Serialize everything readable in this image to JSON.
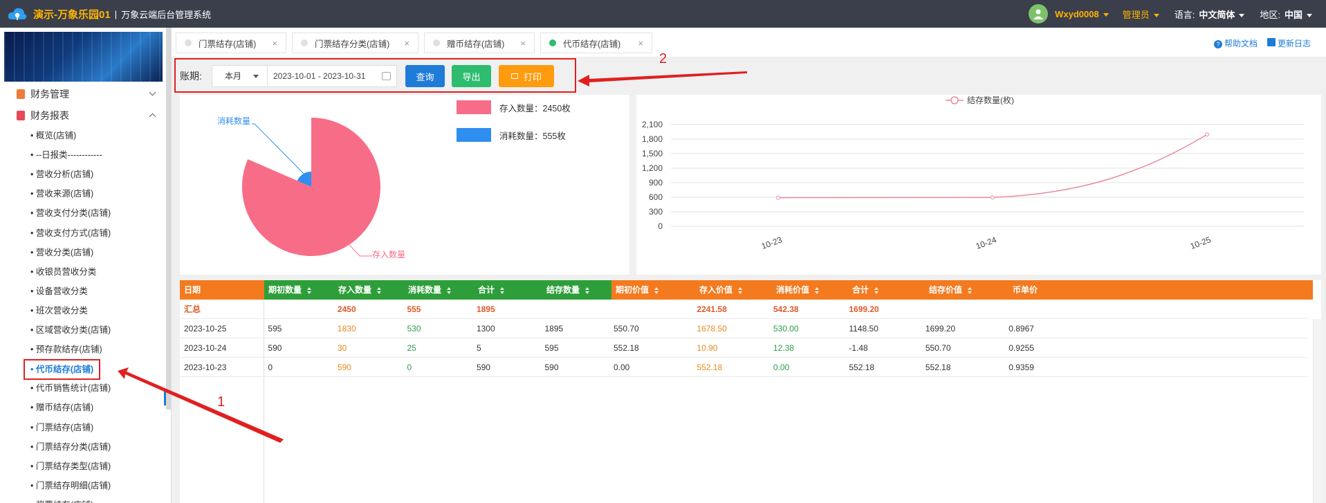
{
  "header": {
    "app_name": "演示-万象乐园01",
    "separator": "|",
    "system_name": "万象云端后台管理系统",
    "username": "Wxyd0008",
    "role": "管理员",
    "language_label": "语言:",
    "language_value": "中文简体",
    "region_label": "地区:",
    "region_value": "中国"
  },
  "sidebar": {
    "groups": [
      {
        "label": "财务管理",
        "icon": "ledger-icon"
      },
      {
        "label": "财务报表",
        "icon": "report-icon"
      }
    ],
    "items": [
      "• 概览(店铺)",
      "• --日报类------------",
      "• 营收分析(店铺)",
      "• 营收来源(店铺)",
      "• 营收支付分类(店铺)",
      "• 营收支付方式(店铺)",
      "• 营收分类(店铺)",
      "• 收银员营收分类",
      "• 设备营收分类",
      "• 班次营收分类",
      "• 区域营收分类(店铺)",
      "• 预存款结存(店铺)",
      "• 代币结存(店铺)",
      "• 代币销售统计(店铺)",
      "• 赠币结存(店铺)",
      "• 门票结存(店铺)",
      "• 门票结存分类(店铺)",
      "• 门票结存类型(店铺)",
      "• 门票结存明细(店铺)",
      "• 奖票结存(店铺)"
    ],
    "active_index": 12
  },
  "tabs": [
    {
      "label": "门票结存(店铺)",
      "active": false
    },
    {
      "label": "门票结存分类(店铺)",
      "active": false
    },
    {
      "label": "赠币结存(店铺)",
      "active": false
    },
    {
      "label": "代币结存(店铺)",
      "active": true
    }
  ],
  "top_links": {
    "help": "帮助文档",
    "changelog": "更新日志"
  },
  "toolbar": {
    "period_label": "账期:",
    "period_value": "本月",
    "date_range": "2023-10-01 - 2023-10-31",
    "query_label": "查询",
    "export_label": "导出",
    "print_label": "打印"
  },
  "annotations": {
    "num1": "1",
    "num2": "2"
  },
  "chart_data": [
    {
      "type": "pie",
      "categories": [
        "存入数量",
        "消耗数量"
      ],
      "values": [
        2450,
        555
      ],
      "legend": [
        "存入数量：2450枚",
        "消耗数量：555枚"
      ],
      "colors": [
        "#f76d87",
        "#2f8ff0"
      ]
    },
    {
      "type": "line",
      "series": [
        {
          "name": "结存数量(枚)",
          "values": [
            590,
            595,
            1895
          ]
        }
      ],
      "x": [
        "10-23",
        "10-24",
        "10-25"
      ],
      "ylim": [
        0,
        2100
      ],
      "yticks": [
        "0",
        "300",
        "600",
        "900",
        "1,200",
        "1,500",
        "1,800",
        "2,100"
      ],
      "color": "#e88a9a",
      "grid": true,
      "legend_position": "top"
    }
  ],
  "table": {
    "headers": [
      "日期",
      "期初数量",
      "存入数量",
      "消耗数量",
      "合计",
      "结存数量",
      "期初价值",
      "存入价值",
      "消耗价值",
      "合计",
      "结存价值",
      "币单价"
    ],
    "summary": [
      "汇总",
      "",
      "2450",
      "555",
      "1895",
      "",
      "",
      "2241.58",
      "542.38",
      "1699.20",
      "",
      ""
    ],
    "rows": [
      [
        "2023-10-25",
        "595",
        "1830",
        "530",
        "1300",
        "1895",
        "550.70",
        "1678.50",
        "530.00",
        "1148.50",
        "1699.20",
        "0.8967"
      ],
      [
        "2023-10-24",
        "590",
        "30",
        "25",
        "5",
        "595",
        "552.18",
        "10.90",
        "12.38",
        "-1.48",
        "550.70",
        "0.9255"
      ],
      [
        "2023-10-23",
        "0",
        "590",
        "0",
        "590",
        "590",
        "0.00",
        "552.18",
        "0.00",
        "552.18",
        "552.18",
        "0.9359"
      ]
    ]
  }
}
